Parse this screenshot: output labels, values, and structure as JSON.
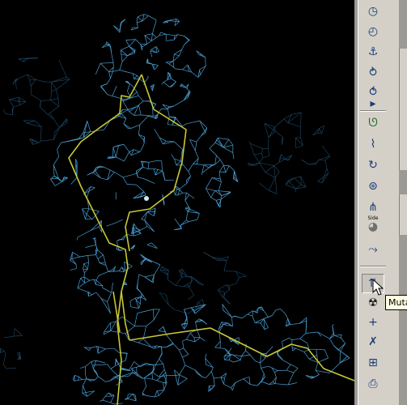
{
  "viewport": {
    "background": "#000000",
    "map_mesh_color": "#4a9fd4",
    "dim_mesh_color": "#1e4a6a",
    "model_trace_color": "#c8c832"
  },
  "toolbar": {
    "background": "#d4d0c8",
    "icon_color": "#1a3c7a",
    "buttons": [
      {
        "name": "clock-icon",
        "glyph": "◷"
      },
      {
        "name": "clock-outline-icon",
        "glyph": "◴"
      },
      {
        "name": "anchor-bond-icon",
        "glyph": "⚓"
      },
      {
        "name": "torsion-icon",
        "glyph": "⥁"
      },
      {
        "name": "torsion-general-icon",
        "glyph": "⥀"
      },
      {
        "name": "expand-arrow-icon",
        "glyph": "▸"
      },
      {
        "name": "rotamer-icon",
        "glyph": "ᘎ"
      },
      {
        "name": "bond-edit-icon",
        "glyph": "⌇"
      },
      {
        "name": "rotate-bond-icon",
        "glyph": "↻"
      },
      {
        "name": "sphere-refine-icon",
        "glyph": "⊛"
      },
      {
        "name": "pepflip-icon",
        "glyph": "⋔"
      },
      {
        "name": "side-chain-icon",
        "glyph": "◕",
        "label": "Side"
      },
      {
        "name": "backbone-torsion-icon",
        "glyph": "⤳"
      },
      {
        "name": "mutate-icon",
        "glyph": "⇅"
      },
      {
        "name": "radiation-mutate-icon",
        "glyph": "☢"
      },
      {
        "name": "add-atom-icon",
        "glyph": "+"
      },
      {
        "name": "delete-atom-icon",
        "glyph": "✗"
      },
      {
        "name": "add-terminal-icon",
        "glyph": "⊞"
      },
      {
        "name": "print-icon",
        "glyph": "⎙"
      }
    ]
  },
  "tooltip": {
    "text": "Mutate"
  }
}
